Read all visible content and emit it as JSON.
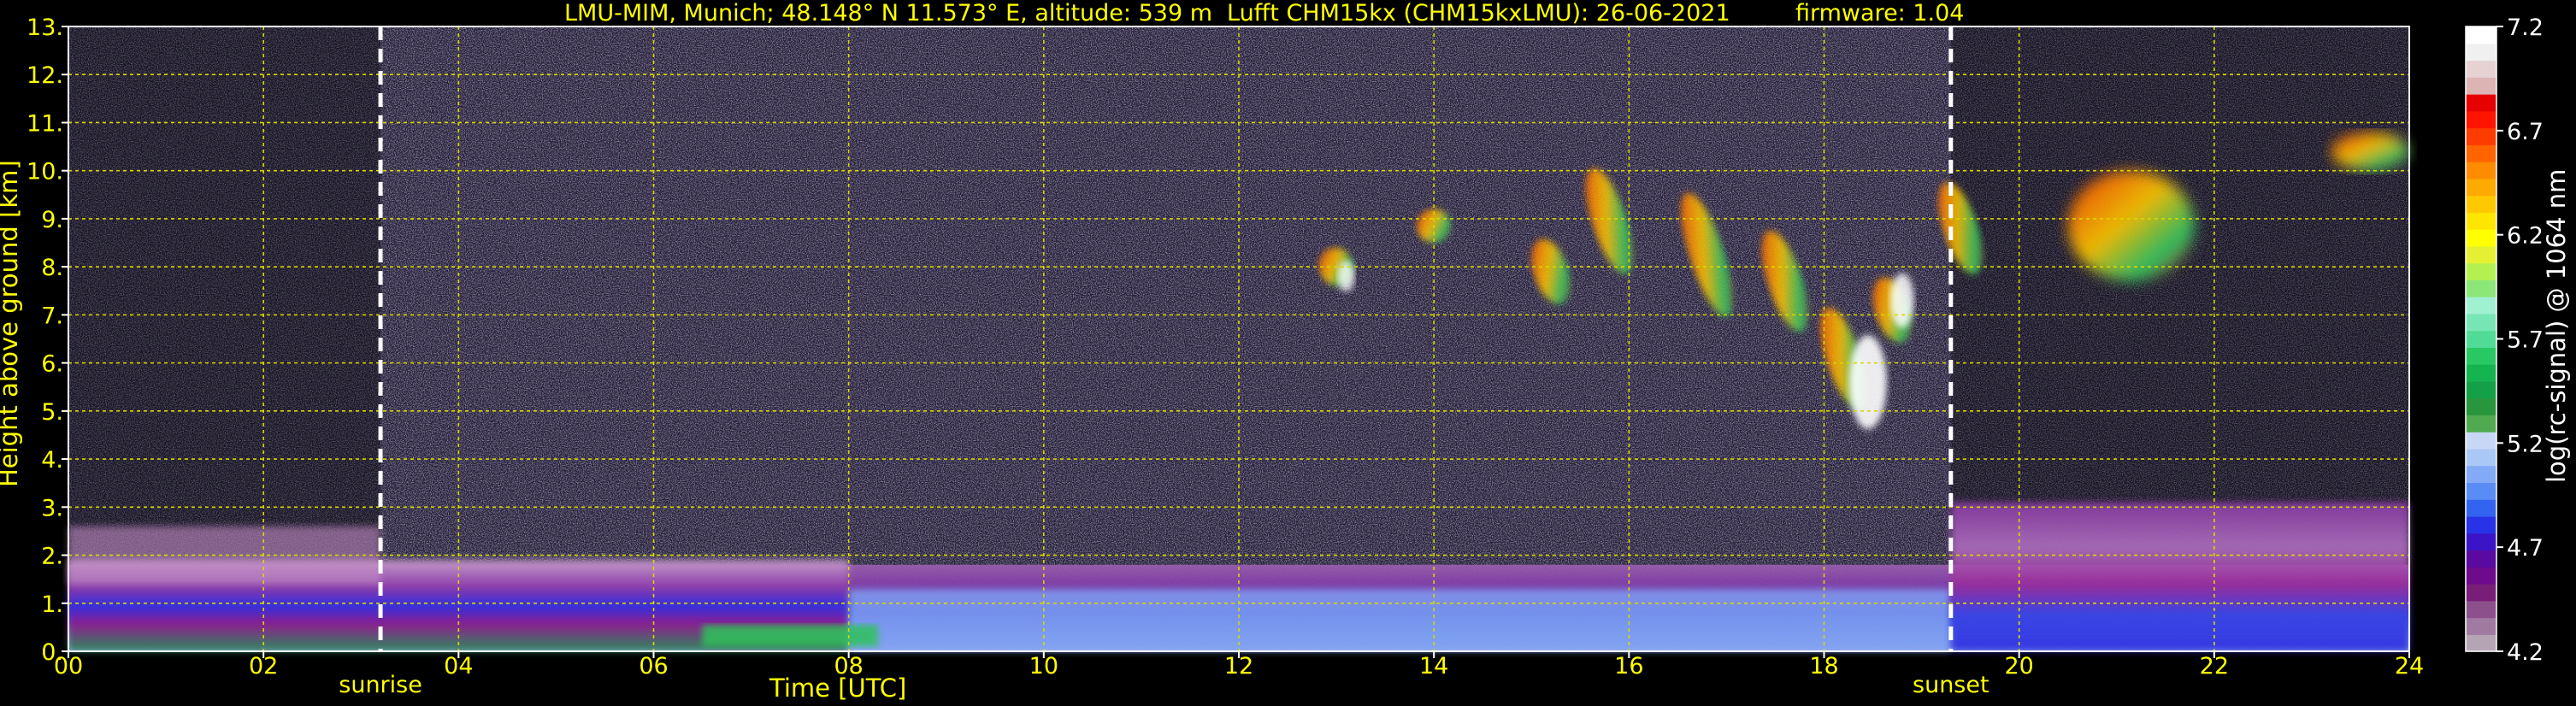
{
  "title": {
    "site": "LMU-MIM, Munich; 48.148° N 11.573° E, altitude: 539 m",
    "instrument": "Lufft CHM15kx (CHM15kxLMU): 26-06-2021",
    "firmware": "firmware: 1.04"
  },
  "chart_data": {
    "type": "heatmap",
    "xlabel": "Time [UTC]",
    "ylabel": "Height above ground [km]",
    "xlim": [
      0,
      24
    ],
    "ylim": [
      0,
      13
    ],
    "x_ticks": [
      "00",
      "02",
      "04",
      "06",
      "08",
      "10",
      "12",
      "14",
      "16",
      "18",
      "20",
      "22",
      "24"
    ],
    "y_ticks": [
      "0.",
      "1.",
      "2.",
      "3.",
      "4.",
      "5.",
      "6.",
      "7.",
      "8.",
      "9.",
      "10.",
      "11.",
      "12.",
      "13."
    ],
    "grid": true,
    "markers": [
      {
        "label": "sunrise",
        "time": 3.2
      },
      {
        "label": "sunset",
        "time": 19.3
      }
    ],
    "colorbar": {
      "label": "log(rc-signal) @ 1064 nm",
      "range": [
        4.2,
        7.2
      ],
      "ticks": [
        "7.2",
        "6.7",
        "6.2",
        "5.7",
        "5.2",
        "4.7",
        "4.2"
      ],
      "colors": [
        "#b4a4b4",
        "#a07aa0",
        "#8c508c",
        "#781e78",
        "#6e0a8c",
        "#5a0aa0",
        "#3c14c8",
        "#2832e6",
        "#3264f0",
        "#5a8cf5",
        "#82aaf5",
        "#aac8f5",
        "#c8d7f5",
        "#50aa50",
        "#28963c",
        "#14a046",
        "#14b450",
        "#28c864",
        "#50dc96",
        "#78e6b4",
        "#a0f0d2",
        "#8ce678",
        "#b4f050",
        "#e6f032",
        "#ffff00",
        "#ffe600",
        "#ffc800",
        "#ffaa00",
        "#ff8c00",
        "#ff6400",
        "#ff3c00",
        "#ff1400",
        "#e60000",
        "#dcb4b4",
        "#e6d2d2",
        "#f0f0f0",
        "#ffffff"
      ]
    },
    "features": [
      {
        "type": "boundary_layer",
        "time": [
          0,
          24
        ],
        "height_km": [
          0,
          1.8
        ]
      },
      {
        "type": "residual_layer",
        "time": [
          0,
          3.2
        ],
        "height_km": [
          1.4,
          2.6
        ]
      },
      {
        "type": "elevated_layer",
        "time": [
          19.3,
          24
        ],
        "height_km": [
          1.5,
          3.1
        ]
      },
      {
        "type": "cirrus",
        "time": [
          12.3,
          19.3
        ],
        "height_km": [
          4.8,
          10.2
        ]
      },
      {
        "type": "cirrus",
        "time": [
          20.5,
          21.8
        ],
        "height_km": [
          7.7,
          10.0
        ]
      },
      {
        "type": "cirrus",
        "time": [
          23.2,
          24
        ],
        "height_km": [
          10.0,
          10.8
        ]
      }
    ]
  }
}
